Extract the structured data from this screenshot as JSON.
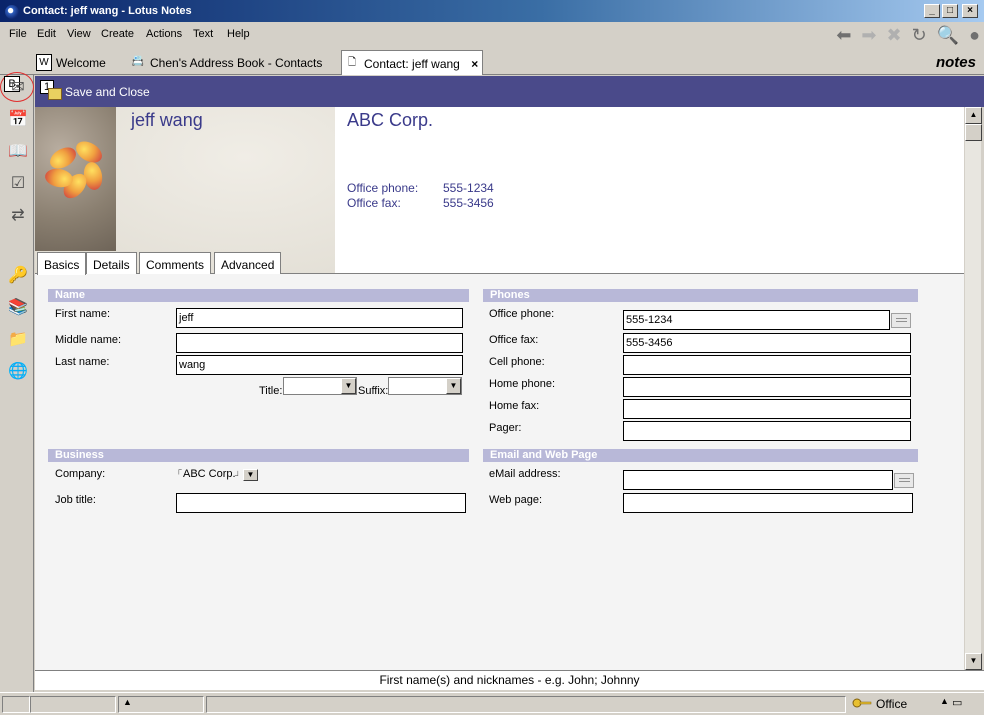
{
  "window": {
    "title": "Contact: jeff wang - Lotus Notes",
    "min_label": "_",
    "max_label": "□",
    "close_label": "×"
  },
  "menu": [
    "File",
    "Edit",
    "View",
    "Create",
    "Actions",
    "Text",
    "Help"
  ],
  "tabs": [
    {
      "label": "Welcome",
      "icon_label": "W"
    },
    {
      "label": "Chen's Address Book - Contacts",
      "icon_label": ""
    },
    {
      "label": "Contact: jeff wang",
      "icon_label": ""
    }
  ],
  "tab_close": "×",
  "brand": "notes",
  "sidebar": {
    "b_label": "B"
  },
  "actionbar": {
    "num_label": "1",
    "save_close": "Save and Close"
  },
  "header": {
    "name": "jeff wang",
    "company": "ABC Corp.",
    "office_phone_label": "Office phone:",
    "office_phone": "555-1234",
    "office_fax_label": "Office fax:",
    "office_fax": "555-3456"
  },
  "doc_tabs": [
    "Basics",
    "Details",
    "Comments",
    "Advanced"
  ],
  "sections": {
    "name": "Name",
    "phones": "Phones",
    "business": "Business",
    "email_web": "Email and Web Page"
  },
  "name_fields": {
    "first_label": "First name:",
    "first_value": "jeff",
    "middle_label": "Middle name:",
    "middle_value": "",
    "last_label": "Last name:",
    "last_value": "wang",
    "title_label": "Title:",
    "suffix_label": "Suffix:"
  },
  "phone_fields": [
    {
      "label": "Office phone:",
      "value": "555-1234"
    },
    {
      "label": "Office fax:",
      "value": "555-3456"
    },
    {
      "label": "Cell phone:",
      "value": ""
    },
    {
      "label": "Home phone:",
      "value": ""
    },
    {
      "label": "Home fax:",
      "value": ""
    },
    {
      "label": "Pager:",
      "value": ""
    }
  ],
  "business_fields": {
    "company_label": "Company:",
    "company_value": "ABC Corp.",
    "job_label": "Job title:",
    "job_value": ""
  },
  "email_fields": {
    "email_label": "eMail address:",
    "email_value": "",
    "web_label": "Web page:",
    "web_value": ""
  },
  "hint": "First name(s) and nicknames - e.g. John; Johnny",
  "status": {
    "location": "Office"
  }
}
